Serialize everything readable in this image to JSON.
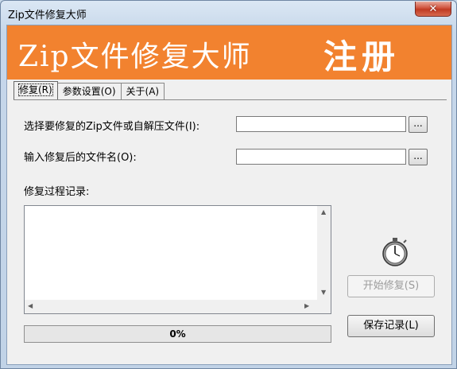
{
  "window": {
    "title": "Zip文件修复大师"
  },
  "banner": {
    "title": "Zip文件修复大师",
    "register": "注册"
  },
  "tabs": [
    {
      "label": "修复(R)"
    },
    {
      "label": "参数设置(O)"
    },
    {
      "label": "关于(A)"
    }
  ],
  "form": {
    "source_label": "选择要修复的Zip文件或自解压文件(I):",
    "source_value": "",
    "output_label": "输入修复后的文件名(O):",
    "output_value": "",
    "browse_label": "...",
    "log_label": "修复过程记录:"
  },
  "progress": {
    "value": 0,
    "text": "0%"
  },
  "buttons": {
    "start": "开始修复(S)",
    "save": "保存记录(L)"
  },
  "icons": {
    "close": "close-icon",
    "timer": "stopwatch-icon"
  },
  "colors": {
    "banner": "#f2822f",
    "close_button": "#c03a23"
  }
}
